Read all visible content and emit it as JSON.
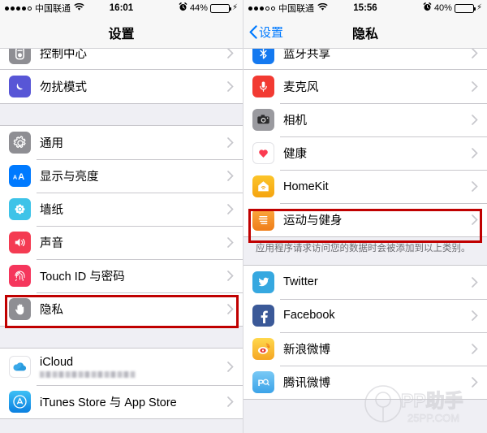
{
  "left_screen": {
    "status_bar": {
      "signal_filled": 4,
      "signal_hollow": 1,
      "carrier": "中国联通",
      "wifi_icon": "wifi-icon",
      "time": "16:01",
      "alarm_icon": "alarm-clock-icon",
      "battery_percent": "44%",
      "battery_level": 44,
      "charging_icon": "lightning-bolt-icon"
    },
    "nav": {
      "title": "设置"
    },
    "groups": [
      {
        "partial_top": true,
        "rows": [
          {
            "label": "控制中心",
            "icon": "control-center-icon",
            "icon_color": "#8e8e93"
          },
          {
            "label": "勿扰模式",
            "icon": "moon-icon",
            "icon_color": "#5856d6"
          }
        ]
      },
      {
        "rows": [
          {
            "label": "通用",
            "icon": "gear-icon",
            "icon_color": "#8e8e93"
          },
          {
            "label": "显示与亮度",
            "icon": "text-size-icon",
            "icon_color": "#007aff"
          },
          {
            "label": "墙纸",
            "icon": "wallpaper-flower-icon",
            "icon_color": "#3ec3e8"
          },
          {
            "label": "声音",
            "icon": "speaker-icon",
            "icon_color": "#f43b52"
          },
          {
            "label": "Touch ID 与密码",
            "icon": "fingerprint-icon",
            "icon_color": "#f5365c"
          },
          {
            "label": "隐私",
            "icon": "hand-icon",
            "icon_color": "#8e8e93",
            "highlighted": true
          }
        ]
      },
      {
        "rows": [
          {
            "label": "iCloud",
            "icon": "icloud-icon",
            "icon_color": "#ffffff",
            "subtitle_redacted": true
          },
          {
            "label": "iTunes Store 与 App Store",
            "icon": "app-store-icon",
            "icon_color": "#1ba5f0"
          }
        ]
      }
    ],
    "highlight_label": "隐私"
  },
  "right_screen": {
    "status_bar": {
      "signal_filled": 3,
      "signal_hollow": 2,
      "carrier": "中国联通",
      "wifi_icon": "wifi-icon",
      "time": "15:56",
      "alarm_icon": "alarm-clock-icon",
      "battery_percent": "40%",
      "battery_level": 40,
      "charging_icon": "lightning-bolt-icon"
    },
    "nav": {
      "back_label": "设置",
      "title": "隐私"
    },
    "groups": [
      {
        "partial_top": true,
        "rows": [
          {
            "label": "蓝牙共享",
            "icon": "bluetooth-icon",
            "icon_color": "#1479f0"
          },
          {
            "label": "麦克风",
            "icon": "microphone-icon",
            "icon_color": "#f23a32"
          },
          {
            "label": "相机",
            "icon": "camera-icon",
            "icon_color": "#8e8e93"
          },
          {
            "label": "健康",
            "icon": "heart-icon",
            "icon_color": "#ffffff"
          },
          {
            "label": "HomeKit",
            "icon": "homekit-house-icon",
            "icon_color": "#f7b519"
          },
          {
            "label": "运动与健身",
            "icon": "motion-fitness-icon",
            "icon_color": "#f08a21",
            "highlighted": true
          }
        ],
        "footnote": "应用程序请求访问您的数据时会被添加到以上类别。"
      },
      {
        "rows": [
          {
            "label": "Twitter",
            "icon": "twitter-icon",
            "icon_color": "#36a8e0"
          },
          {
            "label": "Facebook",
            "icon": "facebook-icon",
            "icon_color": "#3b5998"
          },
          {
            "label": "新浪微博",
            "icon": "sina-weibo-icon",
            "icon_color": "#f5a623"
          },
          {
            "label": "腾讯微博",
            "icon": "tencent-weibo-icon",
            "icon_color": "#4fb3ef"
          }
        ]
      }
    ],
    "highlight_label": "运动与健身",
    "watermark": {
      "brand": "PP助手",
      "url": "25PP.COM"
    }
  },
  "colors": {
    "highlight_border": "#c00000",
    "tint_blue": "#007aff",
    "group_bg": "#ffffff",
    "page_bg": "#efeff4",
    "separator": "#c8c7cc"
  }
}
